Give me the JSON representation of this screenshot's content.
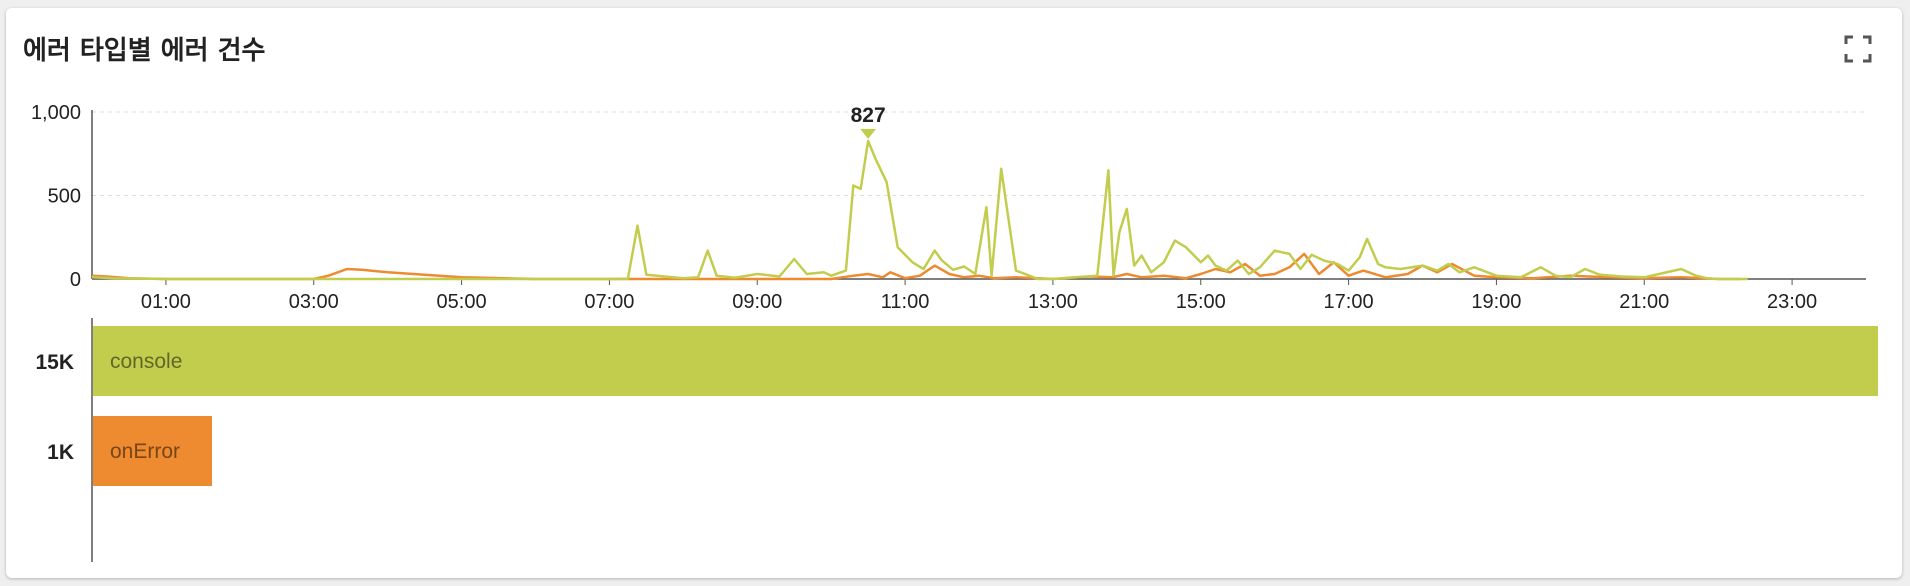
{
  "panel": {
    "title": "에러 타입별 에러 건수",
    "expand_icon": "fullscreen-icon"
  },
  "colors": {
    "console": "#c2cd4e",
    "onError": "#ee8a2f",
    "axis": "#555555",
    "grid": "#dddddd"
  },
  "chart_data": [
    {
      "type": "line",
      "title": "",
      "xlabel": "",
      "ylabel": "",
      "x_unit": "hour of day",
      "xlim": [
        0,
        24
      ],
      "ylim": [
        0,
        1000
      ],
      "y_ticks": [
        "0",
        "500",
        "1,000"
      ],
      "y_tick_values": [
        0,
        500,
        1000
      ],
      "x_ticks": [
        "01:00",
        "03:00",
        "05:00",
        "07:00",
        "09:00",
        "11:00",
        "13:00",
        "15:00",
        "17:00",
        "19:00",
        "21:00",
        "23:00"
      ],
      "x_tick_values": [
        1,
        3,
        5,
        7,
        9,
        11,
        13,
        15,
        17,
        19,
        21,
        23
      ],
      "grid": "horizontal dashed",
      "peak_annotation": {
        "label": "827",
        "x": 10.5,
        "y": 827
      },
      "series": [
        {
          "key": "console",
          "x": [
            0,
            0.3,
            1,
            2,
            3,
            4,
            5,
            6,
            7,
            7.25,
            7.38,
            7.5,
            8,
            8.2,
            8.33,
            8.45,
            8.7,
            9,
            9.3,
            9.5,
            9.67,
            9.9,
            10,
            10.2,
            10.3,
            10.4,
            10.5,
            10.6,
            10.75,
            10.9,
            11.1,
            11.25,
            11.4,
            11.5,
            11.65,
            11.8,
            11.95,
            12.1,
            12.17,
            12.3,
            12.5,
            12.8,
            13,
            13.3,
            13.6,
            13.75,
            13.82,
            13.9,
            14,
            14.1,
            14.2,
            14.33,
            14.5,
            14.65,
            14.8,
            15,
            15.1,
            15.2,
            15.35,
            15.5,
            15.65,
            15.8,
            16,
            16.1,
            16.2,
            16.35,
            16.5,
            16.67,
            16.85,
            17,
            17.15,
            17.25,
            17.4,
            17.5,
            17.7,
            18,
            18.2,
            18.35,
            18.5,
            18.7,
            19,
            19.33,
            19.6,
            19.8,
            20,
            20.2,
            20.4,
            20.7,
            21,
            21.5,
            21.7,
            21.85,
            22,
            22.4
          ],
          "values": [
            10,
            5,
            0,
            0,
            0,
            0,
            0,
            0,
            0,
            2,
            320,
            25,
            5,
            10,
            170,
            20,
            8,
            30,
            15,
            120,
            30,
            40,
            20,
            50,
            560,
            540,
            827,
            720,
            580,
            190,
            100,
            60,
            170,
            110,
            55,
            75,
            30,
            430,
            20,
            660,
            50,
            0,
            0,
            10,
            20,
            650,
            20,
            280,
            420,
            80,
            140,
            40,
            100,
            230,
            190,
            100,
            140,
            80,
            50,
            110,
            30,
            70,
            170,
            160,
            150,
            60,
            145,
            110,
            90,
            50,
            130,
            240,
            90,
            70,
            60,
            80,
            50,
            90,
            40,
            70,
            20,
            10,
            70,
            20,
            10,
            60,
            25,
            15,
            10,
            60,
            20,
            5,
            0,
            0
          ]
        },
        {
          "key": "onError",
          "x": [
            0,
            0.2,
            0.5,
            1,
            2,
            3,
            3.2,
            3.45,
            3.65,
            4,
            5,
            6,
            7,
            8,
            9,
            10,
            10.3,
            10.5,
            10.7,
            10.8,
            11,
            11.2,
            11.4,
            11.6,
            11.8,
            12,
            12.2,
            12.5,
            13,
            13.5,
            13.8,
            14,
            14.2,
            14.5,
            14.8,
            15,
            15.2,
            15.4,
            15.6,
            15.8,
            16,
            16.2,
            16.4,
            16.6,
            16.8,
            17,
            17.2,
            17.5,
            17.8,
            18,
            18.2,
            18.4,
            18.7,
            19,
            19.5,
            20,
            20.5,
            21,
            21.5,
            22,
            22.3
          ],
          "values": [
            20,
            15,
            5,
            0,
            0,
            0,
            20,
            60,
            55,
            40,
            10,
            0,
            0,
            0,
            0,
            0,
            20,
            30,
            10,
            40,
            5,
            20,
            80,
            30,
            10,
            20,
            5,
            10,
            0,
            15,
            10,
            30,
            10,
            20,
            5,
            30,
            60,
            40,
            90,
            20,
            30,
            70,
            150,
            30,
            100,
            20,
            50,
            10,
            30,
            80,
            40,
            90,
            20,
            10,
            5,
            20,
            10,
            5,
            10,
            0,
            0
          ]
        }
      ]
    },
    {
      "type": "bar",
      "orientation": "horizontal",
      "title": "",
      "categories": [
        "console",
        "onError"
      ],
      "value_labels": [
        "15K",
        "1K"
      ],
      "values": [
        15000,
        1000
      ],
      "xlim": [
        0,
        15000
      ]
    }
  ]
}
